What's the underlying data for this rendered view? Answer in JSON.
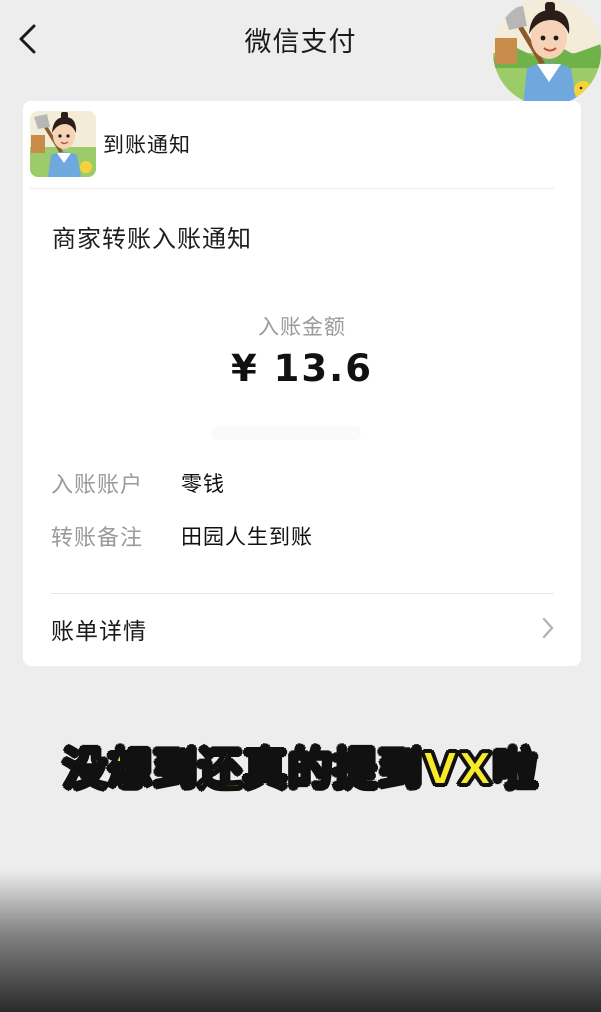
{
  "nav": {
    "title": "微信支付",
    "back_icon": "chevron-left-icon"
  },
  "card": {
    "app_name": "到账通知",
    "notice_title": "商家转账入账通知",
    "amount_label": "入账金额",
    "amount_value": "¥ 13.6",
    "rows": [
      {
        "label": "入账账户",
        "value": "零钱"
      },
      {
        "label": "转账备注",
        "value": "田园人生到账"
      }
    ],
    "detail_label": "账单详情",
    "detail_icon": "chevron-right-icon"
  },
  "caption": "没想到还真的提到VX啦",
  "colors": {
    "background": "#ededed",
    "card": "#ffffff",
    "caption_fill": "#f7ea2a",
    "caption_stroke": "#111111"
  }
}
